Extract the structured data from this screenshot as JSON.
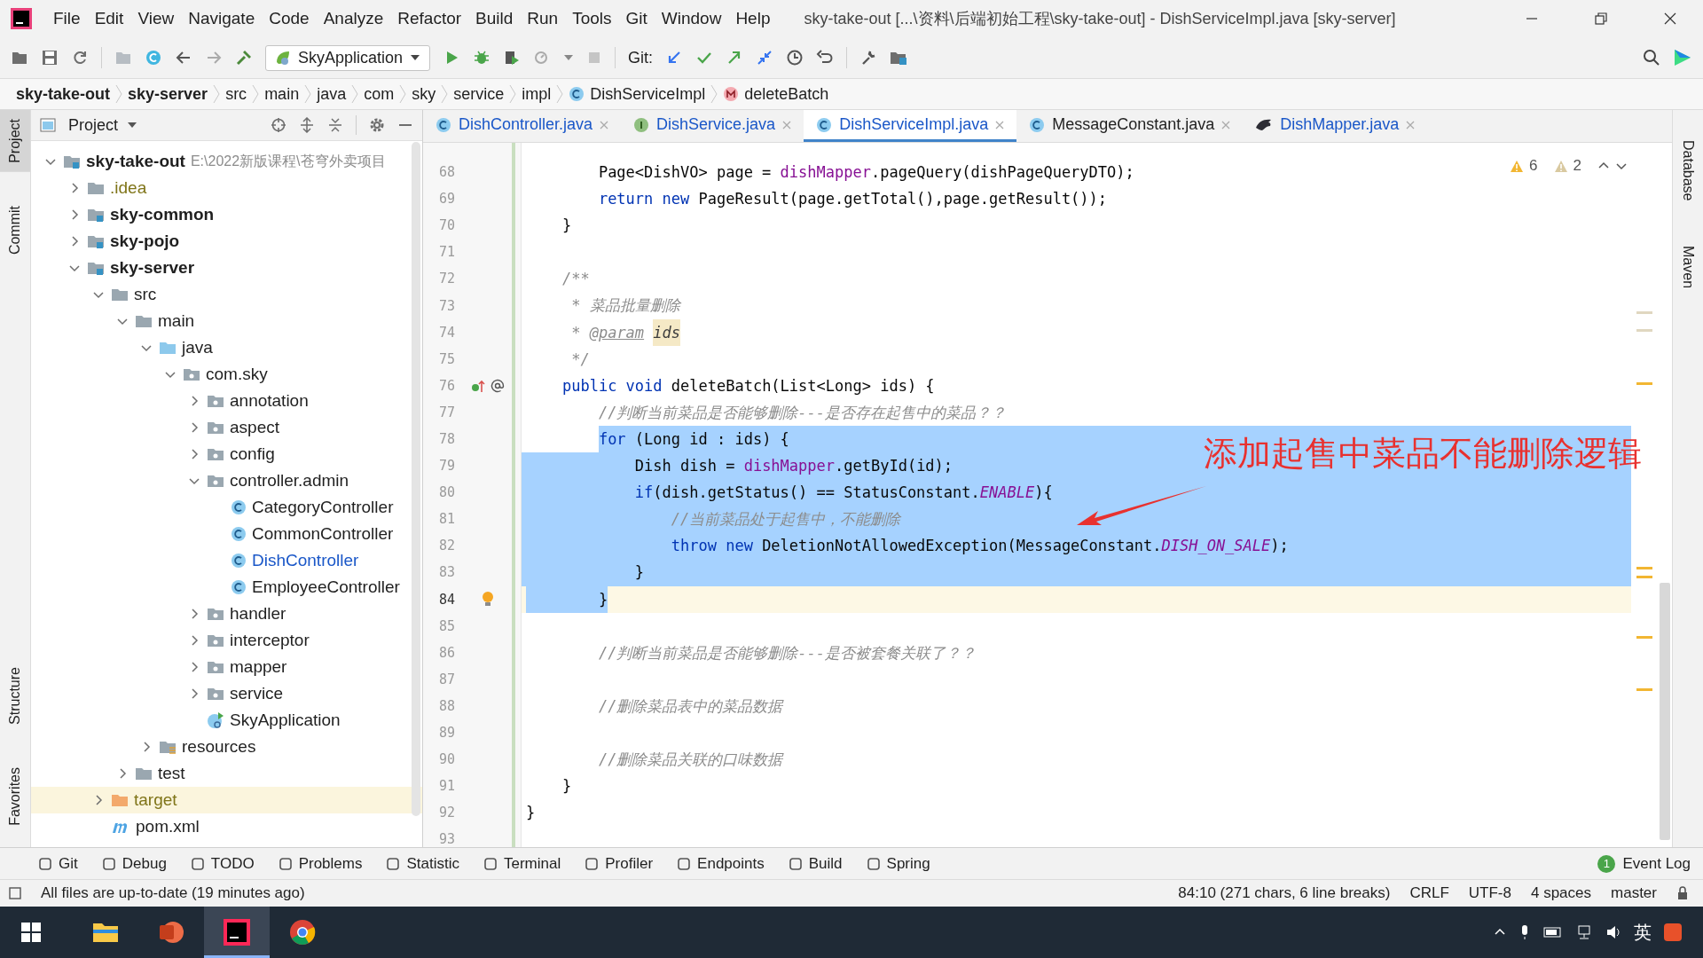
{
  "window": {
    "title": "sky-take-out [...\\资料\\后端初始工程\\sky-take-out] - DishServiceImpl.java [sky-server]"
  },
  "menu": [
    "File",
    "Edit",
    "View",
    "Navigate",
    "Code",
    "Analyze",
    "Refactor",
    "Build",
    "Run",
    "Tools",
    "Git",
    "Window",
    "Help"
  ],
  "toolbar": {
    "run_config": "SkyApplication",
    "git_label": "Git:"
  },
  "breadcrumb": [
    {
      "label": "sky-take-out",
      "kind": "module"
    },
    {
      "label": "sky-server",
      "kind": "module"
    },
    {
      "label": "src",
      "kind": "folder"
    },
    {
      "label": "main",
      "kind": "folder"
    },
    {
      "label": "java",
      "kind": "folder"
    },
    {
      "label": "com",
      "kind": "folder"
    },
    {
      "label": "sky",
      "kind": "folder"
    },
    {
      "label": "service",
      "kind": "folder"
    },
    {
      "label": "impl",
      "kind": "folder"
    },
    {
      "label": "DishServiceImpl",
      "kind": "class"
    },
    {
      "label": "deleteBatch",
      "kind": "method"
    }
  ],
  "left_stripe": {
    "top": [
      {
        "label": "Project",
        "selected": true
      },
      {
        "label": "Commit",
        "selected": false
      }
    ],
    "bottom": [
      {
        "label": "Structure",
        "selected": false
      },
      {
        "label": "Favorites",
        "selected": false
      }
    ]
  },
  "right_stripe": [
    {
      "label": "Database"
    },
    {
      "label": "Maven"
    }
  ],
  "project": {
    "title": "Project",
    "tree": [
      {
        "label": "sky-take-out",
        "path": "E:\\2022新版课程\\苍穹外卖项目",
        "kind": "module",
        "modified": false,
        "ignored": false,
        "selected": false,
        "expanded": true,
        "children": [
          {
            "label": ".idea",
            "kind": "folder",
            "modified": false,
            "ignored": true,
            "selected": false,
            "expanded": false
          },
          {
            "label": "sky-common",
            "kind": "module",
            "modified": false,
            "ignored": false,
            "selected": false,
            "expanded": false
          },
          {
            "label": "sky-pojo",
            "kind": "module",
            "modified": false,
            "ignored": false,
            "selected": false,
            "expanded": false
          },
          {
            "label": "sky-server",
            "kind": "module",
            "modified": false,
            "ignored": false,
            "selected": false,
            "expanded": true,
            "children": [
              {
                "label": "src",
                "kind": "folder",
                "modified": false,
                "ignored": false,
                "selected": false,
                "expanded": true,
                "children": [
                  {
                    "label": "main",
                    "kind": "folder",
                    "modified": false,
                    "ignored": false,
                    "selected": false,
                    "expanded": true,
                    "children": [
                      {
                        "label": "java",
                        "kind": "source",
                        "modified": false,
                        "ignored": false,
                        "selected": false,
                        "expanded": true,
                        "children": [
                          {
                            "label": "com.sky",
                            "kind": "package",
                            "modified": false,
                            "ignored": false,
                            "selected": false,
                            "expanded": true,
                            "children": [
                              {
                                "label": "annotation",
                                "kind": "package",
                                "modified": false,
                                "ignored": false,
                                "selected": false,
                                "expanded": false
                              },
                              {
                                "label": "aspect",
                                "kind": "package",
                                "modified": false,
                                "ignored": false,
                                "selected": false,
                                "expanded": false
                              },
                              {
                                "label": "config",
                                "kind": "package",
                                "modified": false,
                                "ignored": false,
                                "selected": false,
                                "expanded": false
                              },
                              {
                                "label": "controller.admin",
                                "kind": "package",
                                "modified": false,
                                "ignored": false,
                                "selected": false,
                                "expanded": true,
                                "children": [
                                  {
                                    "label": "CategoryController",
                                    "kind": "class",
                                    "modified": false,
                                    "ignored": false,
                                    "selected": false
                                  },
                                  {
                                    "label": "CommonController",
                                    "kind": "class",
                                    "modified": false,
                                    "ignored": false,
                                    "selected": false
                                  },
                                  {
                                    "label": "DishController",
                                    "kind": "class",
                                    "modified": true,
                                    "ignored": false,
                                    "selected": false
                                  },
                                  {
                                    "label": "EmployeeController",
                                    "kind": "class",
                                    "modified": false,
                                    "ignored": false,
                                    "selected": false
                                  }
                                ]
                              },
                              {
                                "label": "handler",
                                "kind": "package",
                                "modified": false,
                                "ignored": false,
                                "selected": false,
                                "expanded": false
                              },
                              {
                                "label": "interceptor",
                                "kind": "package",
                                "modified": false,
                                "ignored": false,
                                "selected": false,
                                "expanded": false
                              },
                              {
                                "label": "mapper",
                                "kind": "package",
                                "modified": false,
                                "ignored": false,
                                "selected": false,
                                "expanded": false
                              },
                              {
                                "label": "service",
                                "kind": "package",
                                "modified": false,
                                "ignored": false,
                                "selected": false,
                                "expanded": false
                              },
                              {
                                "label": "SkyApplication",
                                "kind": "app",
                                "modified": false,
                                "ignored": false,
                                "selected": false
                              }
                            ]
                          }
                        ]
                      },
                      {
                        "label": "resources",
                        "kind": "resources",
                        "modified": false,
                        "ignored": false,
                        "selected": false,
                        "expanded": false
                      }
                    ]
                  },
                  {
                    "label": "test",
                    "kind": "folder",
                    "modified": false,
                    "ignored": false,
                    "selected": false,
                    "expanded": false
                  }
                ]
              },
              {
                "label": "target",
                "kind": "excluded",
                "modified": false,
                "ignored": true,
                "selected": true,
                "expanded": false
              },
              {
                "label": "pom.xml",
                "kind": "maven",
                "modified": false,
                "ignored": false,
                "selected": false
              }
            ]
          }
        ]
      }
    ]
  },
  "tabs": [
    {
      "label": "DishController.java",
      "kind": "class",
      "modified": true,
      "selected": false
    },
    {
      "label": "DishService.java",
      "kind": "interface",
      "modified": true,
      "selected": false
    },
    {
      "label": "DishServiceImpl.java",
      "kind": "class",
      "modified": true,
      "selected": true
    },
    {
      "label": "MessageConstant.java",
      "kind": "class",
      "modified": false,
      "selected": false
    },
    {
      "label": "DishMapper.java",
      "kind": "mapper",
      "modified": true,
      "selected": false
    }
  ],
  "inspections": {
    "warnings": "6",
    "weak_warnings": "2"
  },
  "code_lines": [
    {
      "number": "68",
      "kind": "plain",
      "selected": false,
      "current": false,
      "tokens": [
        {
          "kind": "plain",
          "text": "        Page<DishVO> page = "
        },
        {
          "kind": "field",
          "text": "dishMapper"
        },
        {
          "kind": "plain",
          "text": ".pageQuery(dishPageQueryDTO);"
        }
      ]
    },
    {
      "number": "69",
      "kind": "plain",
      "selected": false,
      "current": false,
      "tokens": [
        {
          "kind": "keyword",
          "text": "        return new"
        },
        {
          "kind": "plain",
          "text": " PageResult(page.getTotal(),page.getResult());"
        }
      ]
    },
    {
      "number": "70",
      "kind": "plain",
      "selected": false,
      "current": false,
      "tokens": [
        {
          "kind": "plain",
          "text": "    }"
        }
      ]
    },
    {
      "number": "71",
      "kind": "plain",
      "selected": false,
      "current": false
    },
    {
      "number": "72",
      "kind": "plain",
      "selected": false,
      "current": false,
      "tokens": [
        {
          "kind": "comment",
          "text": "    /**"
        }
      ]
    },
    {
      "number": "73",
      "kind": "plain",
      "selected": false,
      "current": false,
      "tokens": [
        {
          "kind": "comment",
          "text": "     * 菜品批量删除"
        }
      ]
    },
    {
      "number": "74",
      "kind": "plain",
      "selected": false,
      "current": false,
      "tokens": [
        {
          "kind": "comment",
          "text": "     * "
        },
        {
          "kind": "tag",
          "text": "@param"
        },
        {
          "kind": "param",
          "text": "ids"
        }
      ]
    },
    {
      "number": "75",
      "kind": "plain",
      "selected": false,
      "current": false,
      "tokens": [
        {
          "kind": "comment",
          "text": "     */"
        }
      ]
    },
    {
      "number": "76",
      "kind": "implements",
      "selected": false,
      "current": false,
      "tokens": [
        {
          "kind": "keyword",
          "text": "    public void"
        },
        {
          "kind": "plain",
          "text": " deleteBatch(List<Long> ids) {"
        }
      ]
    },
    {
      "number": "77",
      "kind": "plain",
      "selected": false,
      "current": false,
      "tokens": [
        {
          "kind": "comment",
          "text": "        //判断当前菜品是否能够删除---是否存在起售中的菜品？？"
        }
      ]
    },
    {
      "number": "78",
      "kind": "plain",
      "selected": true,
      "current": false,
      "tokens": [
        {
          "kind": "keyword",
          "text": "        for"
        },
        {
          "kind": "plain",
          "text": " (Long id : ids) {"
        }
      ]
    },
    {
      "number": "79",
      "kind": "plain",
      "selected": true,
      "current": false,
      "tokens": [
        {
          "kind": "plain",
          "text": "            Dish dish = "
        },
        {
          "kind": "field",
          "text": "dishMapper"
        },
        {
          "kind": "plain",
          "text": ".getById(id);"
        }
      ]
    },
    {
      "number": "80",
      "kind": "plain",
      "selected": true,
      "current": false,
      "tokens": [
        {
          "kind": "keyword",
          "text": "            if"
        },
        {
          "kind": "plain",
          "text": "(dish.getStatus() == StatusConstant."
        },
        {
          "kind": "constant",
          "text": "ENABLE"
        },
        {
          "kind": "plain",
          "text": "){"
        }
      ]
    },
    {
      "number": "81",
      "kind": "plain",
      "selected": true,
      "current": false,
      "tokens": [
        {
          "kind": "comment",
          "text": "                //当前菜品处于起售中，不能删除"
        }
      ]
    },
    {
      "number": "82",
      "kind": "plain",
      "selected": true,
      "current": false,
      "tokens": [
        {
          "kind": "keyword",
          "text": "                throw new"
        },
        {
          "kind": "plain",
          "text": " DeletionNotAllowedException(MessageConstant."
        },
        {
          "kind": "constant",
          "text": "DISH_ON_SALE"
        },
        {
          "kind": "plain",
          "text": ");"
        }
      ]
    },
    {
      "number": "83",
      "kind": "plain",
      "selected": true,
      "current": false,
      "tokens": [
        {
          "kind": "plain",
          "text": "            }"
        }
      ]
    },
    {
      "number": "84",
      "kind": "bulb",
      "selected": true,
      "current": true,
      "tokens": [
        {
          "kind": "plain",
          "text": "        }"
        }
      ]
    },
    {
      "number": "85",
      "kind": "plain",
      "selected": false,
      "current": false
    },
    {
      "number": "86",
      "kind": "plain",
      "selected": false,
      "current": false,
      "tokens": [
        {
          "kind": "comment",
          "text": "        //判断当前菜品是否能够删除---是否被套餐关联了？？"
        }
      ]
    },
    {
      "number": "87",
      "kind": "plain",
      "selected": false,
      "current": false
    },
    {
      "number": "88",
      "kind": "plain",
      "selected": false,
      "current": false,
      "tokens": [
        {
          "kind": "comment",
          "text": "        //删除菜品表中的菜品数据"
        }
      ]
    },
    {
      "number": "89",
      "kind": "plain",
      "selected": false,
      "current": false
    },
    {
      "number": "90",
      "kind": "plain",
      "selected": false,
      "current": false,
      "tokens": [
        {
          "kind": "comment",
          "text": "        //删除菜品关联的口味数据"
        }
      ]
    },
    {
      "number": "91",
      "kind": "plain",
      "selected": false,
      "current": false,
      "tokens": [
        {
          "kind": "plain",
          "text": "    }"
        }
      ]
    },
    {
      "number": "92",
      "kind": "plain",
      "selected": false,
      "current": false,
      "tokens": [
        {
          "kind": "plain",
          "text": "}"
        }
      ]
    },
    {
      "number": "93",
      "kind": "plain",
      "selected": false,
      "current": false
    }
  ],
  "annotation": {
    "text": "添加起售中菜品不能删除逻辑"
  },
  "tool_windows": [
    "Git",
    "Debug",
    "TODO",
    "Problems",
    "Statistic",
    "Terminal",
    "Profiler",
    "Endpoints",
    "Build",
    "Spring"
  ],
  "event_log": {
    "label": "Event Log",
    "count": "1"
  },
  "status_bar": {
    "message": "All files are up-to-date (19 minutes ago)",
    "position": "84:10 (271 chars, 6 line breaks)",
    "line_separator": "CRLF",
    "encoding": "UTF-8",
    "indent": "4 spaces",
    "branch": "master"
  },
  "taskbar": {
    "apps": [
      {
        "kind": "explorer",
        "selected": false
      },
      {
        "kind": "powerpoint",
        "selected": false
      },
      {
        "kind": "intellij",
        "selected": true
      },
      {
        "kind": "chrome",
        "selected": false
      }
    ],
    "ime": "英"
  }
}
